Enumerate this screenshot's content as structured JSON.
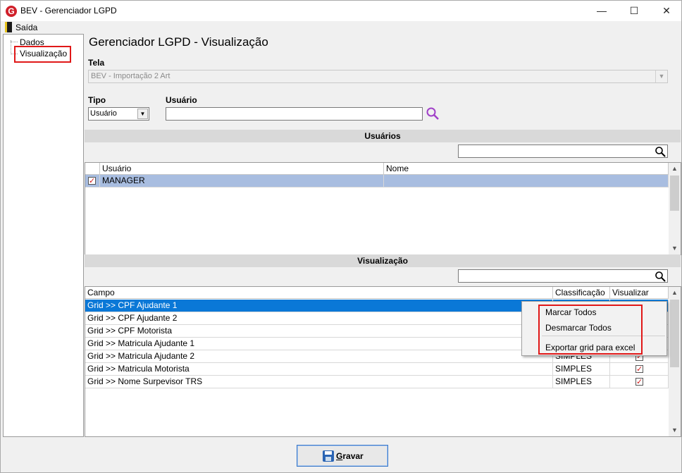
{
  "window": {
    "title": "BEV - Gerenciador LGPD",
    "app_icon": "G"
  },
  "menu": {
    "exit_label": "Saída"
  },
  "tree": {
    "items": [
      "Dados",
      "Visualização"
    ]
  },
  "main": {
    "title": "Gerenciador LGPD - Visualização",
    "tela_label": "Tela",
    "tela_value": "BEV - Importação 2 Art",
    "tipo_label": "Tipo",
    "tipo_value": "Usuário",
    "usuario_label": "Usuário",
    "usuario_value": ""
  },
  "users_section": {
    "title": "Usuários",
    "filter_value": "",
    "columns": [
      "Usuário",
      "Nome"
    ],
    "rows": [
      {
        "checked": true,
        "usuario": "MANAGER",
        "nome": ""
      }
    ]
  },
  "vis_section": {
    "title": "Visualização",
    "filter_value": "",
    "columns": [
      "Campo",
      "Classificação",
      "Visualizar"
    ],
    "rows": [
      {
        "campo": "Grid >> CPF Ajudante 1",
        "classificacao": "",
        "visualizar": true
      },
      {
        "campo": "Grid >> CPF Ajudante 2",
        "classificacao": "",
        "visualizar": true
      },
      {
        "campo": "Grid >> CPF Motorista",
        "classificacao": "",
        "visualizar": true
      },
      {
        "campo": "Grid >> Matricula Ajudante 1",
        "classificacao": "",
        "visualizar": true
      },
      {
        "campo": "Grid >> Matricula Ajudante 2",
        "classificacao": "SIMPLES",
        "visualizar": true
      },
      {
        "campo": "Grid >> Matricula Motorista",
        "classificacao": "SIMPLES",
        "visualizar": true
      },
      {
        "campo": "Grid >> Nome Surpevisor TRS",
        "classificacao": "SIMPLES",
        "visualizar": true
      }
    ]
  },
  "context_menu": {
    "items": [
      "Marcar Todos",
      "Desmarcar Todos",
      "Exportar grid para excel"
    ]
  },
  "footer": {
    "save_label_underlined": "G",
    "save_label_rest": "ravar"
  },
  "colors": {
    "selection_blue": "#0a78d7",
    "selection_lilac": "#a8bde0",
    "highlight_red": "#e01818",
    "search_purple": "#a040c8"
  }
}
